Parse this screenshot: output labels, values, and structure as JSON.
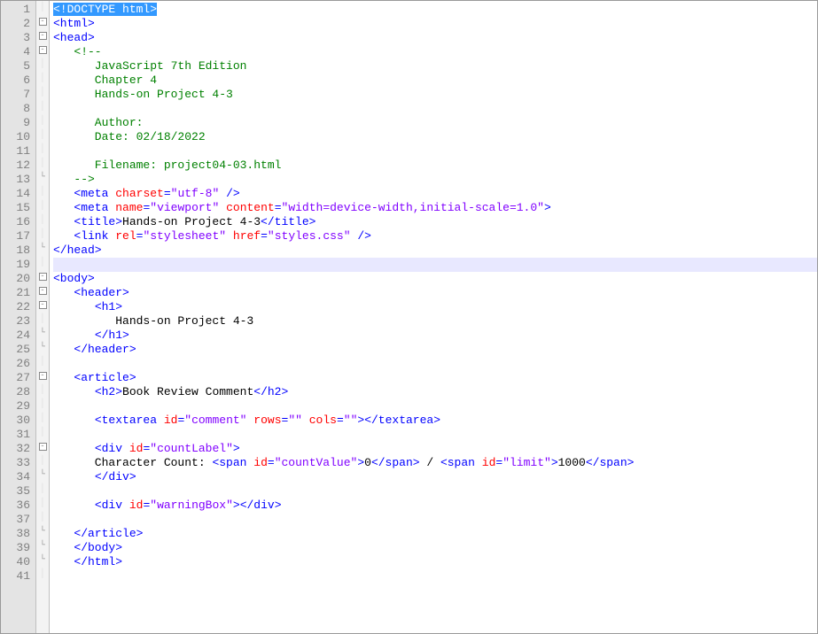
{
  "lineCount": 41,
  "currentLine": 19,
  "fold": {
    "2": "box-minus",
    "3": "box-minus",
    "4": "box-minus",
    "13": "close",
    "18": "close",
    "20": "box-minus",
    "21": "box-minus",
    "22": "box-minus",
    "24": "close",
    "25": "close",
    "27": "box-minus",
    "32": "box-minus",
    "34": "close",
    "38": "close",
    "39": "close",
    "40": "close"
  },
  "lines": {
    "1": [
      {
        "c": "sel",
        "t": "<!DOCTYPE html>"
      }
    ],
    "2": [
      {
        "c": "tag",
        "t": "<html>"
      }
    ],
    "3": [
      {
        "c": "tag",
        "t": "<head>"
      }
    ],
    "4": [
      {
        "c": "txt",
        "t": "   "
      },
      {
        "c": "cmt",
        "t": "<!--"
      }
    ],
    "5": [
      {
        "c": "cmt",
        "t": "      JavaScript 7th Edition"
      }
    ],
    "6": [
      {
        "c": "cmt",
        "t": "      Chapter 4"
      }
    ],
    "7": [
      {
        "c": "cmt",
        "t": "      Hands-on Project 4-3"
      }
    ],
    "8": [
      {
        "c": "cmt",
        "t": ""
      }
    ],
    "9": [
      {
        "c": "cmt",
        "t": "      Author:"
      }
    ],
    "10": [
      {
        "c": "cmt",
        "t": "      Date: 02/18/2022"
      }
    ],
    "11": [
      {
        "c": "cmt",
        "t": ""
      }
    ],
    "12": [
      {
        "c": "cmt",
        "t": "      Filename: project04-03.html"
      }
    ],
    "13": [
      {
        "c": "txt",
        "t": "   "
      },
      {
        "c": "cmt",
        "t": "-->"
      }
    ],
    "14": [
      {
        "c": "txt",
        "t": "   "
      },
      {
        "c": "tag",
        "t": "<meta"
      },
      {
        "c": "txt",
        "t": " "
      },
      {
        "c": "attr",
        "t": "charset"
      },
      {
        "c": "tag",
        "t": "="
      },
      {
        "c": "str",
        "t": "\"utf-8\""
      },
      {
        "c": "txt",
        "t": " "
      },
      {
        "c": "tag",
        "t": "/>"
      }
    ],
    "15": [
      {
        "c": "txt",
        "t": "   "
      },
      {
        "c": "tag",
        "t": "<meta"
      },
      {
        "c": "txt",
        "t": " "
      },
      {
        "c": "attr",
        "t": "name"
      },
      {
        "c": "tag",
        "t": "="
      },
      {
        "c": "str",
        "t": "\"viewport\""
      },
      {
        "c": "txt",
        "t": " "
      },
      {
        "c": "attr",
        "t": "content"
      },
      {
        "c": "tag",
        "t": "="
      },
      {
        "c": "str",
        "t": "\"width=device-width,initial-scale=1.0\""
      },
      {
        "c": "tag",
        "t": ">"
      }
    ],
    "16": [
      {
        "c": "txt",
        "t": "   "
      },
      {
        "c": "tag",
        "t": "<title>"
      },
      {
        "c": "txt",
        "t": "Hands-on Project 4-3"
      },
      {
        "c": "tag",
        "t": "</title>"
      }
    ],
    "17": [
      {
        "c": "txt",
        "t": "   "
      },
      {
        "c": "tag",
        "t": "<link"
      },
      {
        "c": "txt",
        "t": " "
      },
      {
        "c": "attr",
        "t": "rel"
      },
      {
        "c": "tag",
        "t": "="
      },
      {
        "c": "str",
        "t": "\"stylesheet\""
      },
      {
        "c": "txt",
        "t": " "
      },
      {
        "c": "attr",
        "t": "href"
      },
      {
        "c": "tag",
        "t": "="
      },
      {
        "c": "str",
        "t": "\"styles.css\""
      },
      {
        "c": "txt",
        "t": " "
      },
      {
        "c": "tag",
        "t": "/>"
      }
    ],
    "18": [
      {
        "c": "tag",
        "t": "</head>"
      }
    ],
    "19": [
      {
        "c": "txt",
        "t": ""
      }
    ],
    "20": [
      {
        "c": "tag",
        "t": "<body>"
      }
    ],
    "21": [
      {
        "c": "txt",
        "t": "   "
      },
      {
        "c": "tag",
        "t": "<header>"
      }
    ],
    "22": [
      {
        "c": "txt",
        "t": "      "
      },
      {
        "c": "tag",
        "t": "<h1>"
      }
    ],
    "23": [
      {
        "c": "txt",
        "t": "         Hands-on Project 4-3"
      }
    ],
    "24": [
      {
        "c": "txt",
        "t": "      "
      },
      {
        "c": "tag",
        "t": "</h1>"
      }
    ],
    "25": [
      {
        "c": "txt",
        "t": "   "
      },
      {
        "c": "tag",
        "t": "</header>"
      }
    ],
    "26": [
      {
        "c": "txt",
        "t": ""
      }
    ],
    "27": [
      {
        "c": "txt",
        "t": "   "
      },
      {
        "c": "tag",
        "t": "<article>"
      }
    ],
    "28": [
      {
        "c": "txt",
        "t": "      "
      },
      {
        "c": "tag",
        "t": "<h2>"
      },
      {
        "c": "txt",
        "t": "Book Review Comment"
      },
      {
        "c": "tag",
        "t": "</h2>"
      }
    ],
    "29": [
      {
        "c": "txt",
        "t": ""
      }
    ],
    "30": [
      {
        "c": "txt",
        "t": "      "
      },
      {
        "c": "tag",
        "t": "<textarea"
      },
      {
        "c": "txt",
        "t": " "
      },
      {
        "c": "attr",
        "t": "id"
      },
      {
        "c": "tag",
        "t": "="
      },
      {
        "c": "str",
        "t": "\"comment\""
      },
      {
        "c": "txt",
        "t": " "
      },
      {
        "c": "attr",
        "t": "rows"
      },
      {
        "c": "tag",
        "t": "="
      },
      {
        "c": "str",
        "t": "\"\""
      },
      {
        "c": "txt",
        "t": " "
      },
      {
        "c": "attr",
        "t": "cols"
      },
      {
        "c": "tag",
        "t": "="
      },
      {
        "c": "str",
        "t": "\"\""
      },
      {
        "c": "tag",
        "t": "></textarea>"
      }
    ],
    "31": [
      {
        "c": "txt",
        "t": ""
      }
    ],
    "32": [
      {
        "c": "txt",
        "t": "      "
      },
      {
        "c": "tag",
        "t": "<div"
      },
      {
        "c": "txt",
        "t": " "
      },
      {
        "c": "attr",
        "t": "id"
      },
      {
        "c": "tag",
        "t": "="
      },
      {
        "c": "str",
        "t": "\"countLabel\""
      },
      {
        "c": "tag",
        "t": ">"
      }
    ],
    "33": [
      {
        "c": "txt",
        "t": "      Character Count: "
      },
      {
        "c": "tag",
        "t": "<span"
      },
      {
        "c": "txt",
        "t": " "
      },
      {
        "c": "attr",
        "t": "id"
      },
      {
        "c": "tag",
        "t": "="
      },
      {
        "c": "str",
        "t": "\"countValue\""
      },
      {
        "c": "tag",
        "t": ">"
      },
      {
        "c": "txt",
        "t": "0"
      },
      {
        "c": "tag",
        "t": "</span>"
      },
      {
        "c": "txt",
        "t": " / "
      },
      {
        "c": "tag",
        "t": "<span"
      },
      {
        "c": "txt",
        "t": " "
      },
      {
        "c": "attr",
        "t": "id"
      },
      {
        "c": "tag",
        "t": "="
      },
      {
        "c": "str",
        "t": "\"limit\""
      },
      {
        "c": "tag",
        "t": ">"
      },
      {
        "c": "txt",
        "t": "1000"
      },
      {
        "c": "tag",
        "t": "</span>"
      }
    ],
    "34": [
      {
        "c": "txt",
        "t": "      "
      },
      {
        "c": "tag",
        "t": "</div>"
      }
    ],
    "35": [
      {
        "c": "txt",
        "t": ""
      }
    ],
    "36": [
      {
        "c": "txt",
        "t": "      "
      },
      {
        "c": "tag",
        "t": "<div"
      },
      {
        "c": "txt",
        "t": " "
      },
      {
        "c": "attr",
        "t": "id"
      },
      {
        "c": "tag",
        "t": "="
      },
      {
        "c": "str",
        "t": "\"warningBox\""
      },
      {
        "c": "tag",
        "t": "></div>"
      }
    ],
    "37": [
      {
        "c": "txt",
        "t": ""
      }
    ],
    "38": [
      {
        "c": "txt",
        "t": "   "
      },
      {
        "c": "tag",
        "t": "</article>"
      }
    ],
    "39": [
      {
        "c": "txt",
        "t": "   "
      },
      {
        "c": "tag",
        "t": "</body>"
      }
    ],
    "40": [
      {
        "c": "txt",
        "t": "   "
      },
      {
        "c": "tag",
        "t": "</html>"
      }
    ],
    "41": [
      {
        "c": "txt",
        "t": ""
      }
    ]
  }
}
